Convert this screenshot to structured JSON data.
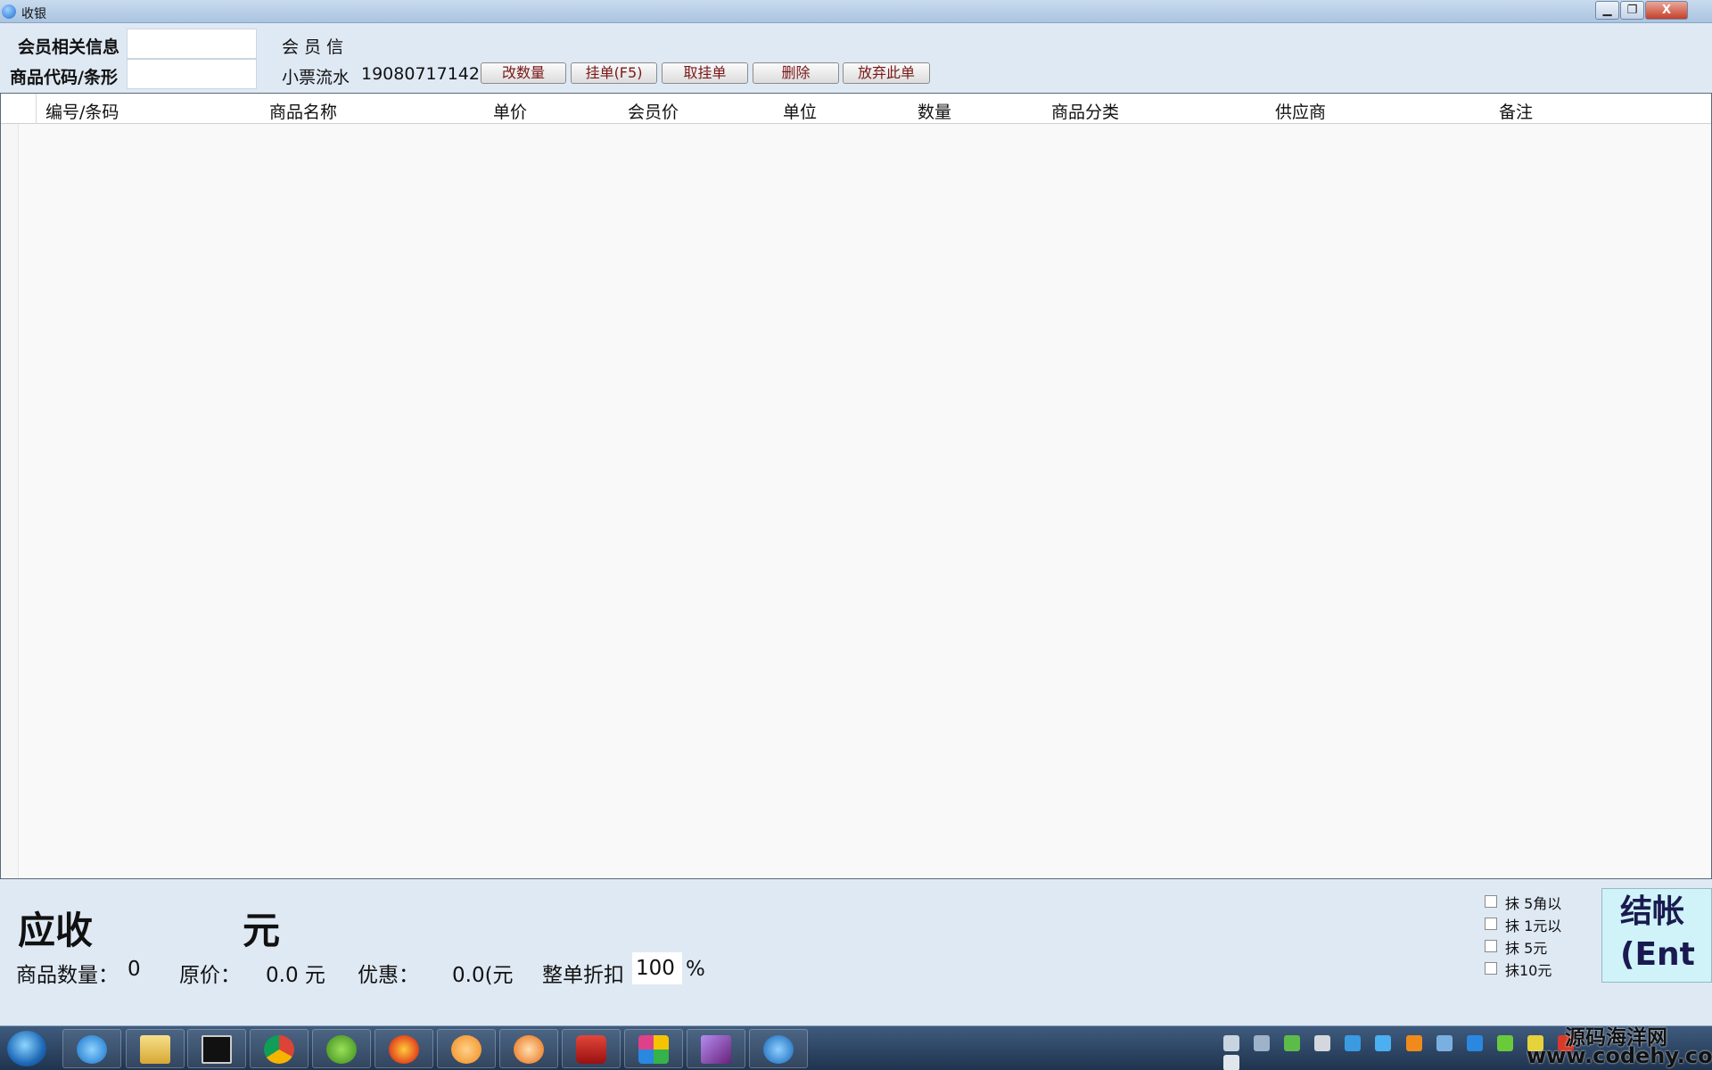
{
  "window": {
    "title": "收银",
    "controls": {
      "minimize": "▁",
      "maximize": "❐",
      "close": "X"
    }
  },
  "form": {
    "member_label": "会员相关信息",
    "member_value": "",
    "product_label": "商品代码/条形",
    "product_value": "",
    "member_info_label": "会 员 信 ",
    "receipt_label": "小票流水",
    "receipt_value": "19080717142"
  },
  "toolbar": {
    "change_qty": "改数量",
    "hold_order": "挂单(F5)",
    "retrieve_order": "取挂单",
    "delete": "删除",
    "abandon_order": "放弃此单"
  },
  "grid": {
    "columns": [
      "编号/条码",
      "商品名称",
      "单价",
      "会员价",
      "单位",
      "数量",
      "商品分类",
      "供应商",
      "备注"
    ],
    "rows": []
  },
  "summary": {
    "receivable_label": "应收",
    "receivable_unit": "元",
    "count_label": "商品数量：",
    "count_value": "0",
    "original_label": "原价：",
    "original_value": "0.0 元",
    "discount_label": "优惠：",
    "discount_value": "0.0(元",
    "whole_discount_label": "整单折扣",
    "whole_discount_value": "100",
    "percent": "%"
  },
  "rounding_options": [
    {
      "label": "抹  5角以",
      "checked": false
    },
    {
      "label": "抹  1元以",
      "checked": false
    },
    {
      "label": "抹  5元",
      "checked": false
    },
    {
      "label": "抹10元",
      "checked": false
    }
  ],
  "checkout": {
    "line1": "结帐",
    "line2": "(Ent"
  },
  "taskbar": {
    "apps": [
      "internet-explorer",
      "file-explorer",
      "terminal",
      "chrome",
      "app-green",
      "firefox",
      "app-orange",
      "app-orange-2",
      "app-security",
      "app-colorful",
      "visual-studio",
      "app-blue"
    ]
  },
  "watermark": {
    "line1": "源码海洋网",
    "line2": "www.codehy.com"
  },
  "colors": {
    "accent": "#cff3f8",
    "button_text": "#7a1818",
    "taskbar": "#2a4363"
  }
}
